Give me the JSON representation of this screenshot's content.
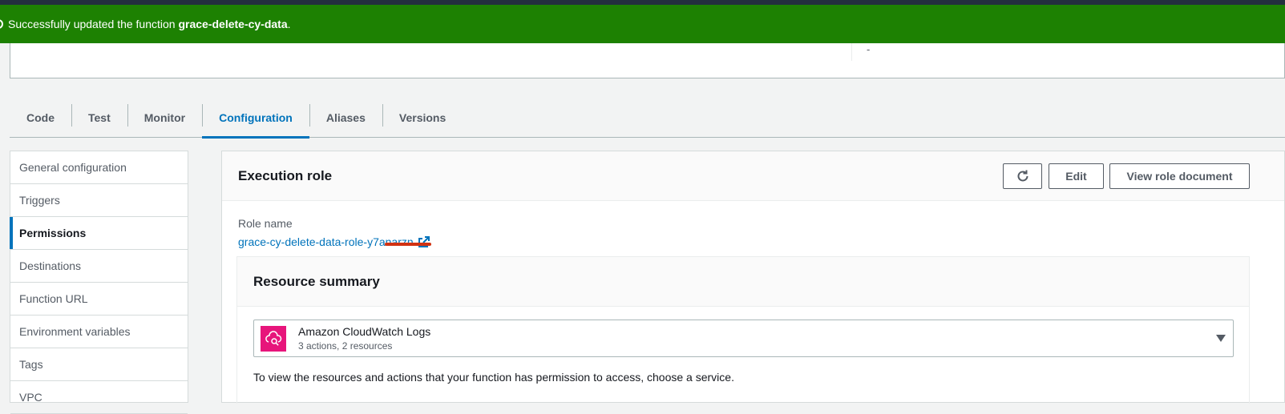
{
  "flash": {
    "prefix": "Successfully updated the function ",
    "function_name": "grace-delete-cy-data",
    "suffix": "."
  },
  "header": {
    "dash": "-"
  },
  "tabs": [
    {
      "label": "Code"
    },
    {
      "label": "Test"
    },
    {
      "label": "Monitor"
    },
    {
      "label": "Configuration",
      "active": true
    },
    {
      "label": "Aliases"
    },
    {
      "label": "Versions"
    }
  ],
  "sidebar": {
    "items": [
      {
        "label": "General configuration"
      },
      {
        "label": "Triggers"
      },
      {
        "label": "Permissions",
        "active": true
      },
      {
        "label": "Destinations"
      },
      {
        "label": "Function URL"
      },
      {
        "label": "Environment variables"
      },
      {
        "label": "Tags"
      },
      {
        "label": "VPC"
      }
    ]
  },
  "execution_role": {
    "title": "Execution role",
    "edit_label": "Edit",
    "view_doc_label": "View role document",
    "role_name_label": "Role name",
    "role_name_value": "grace-cy-delete-data-role-y7anarzn"
  },
  "resource_summary": {
    "title": "Resource summary",
    "service_name": "Amazon CloudWatch Logs",
    "service_sub": "3 actions, 2 resources",
    "hint": "To view the resources and actions that your function has permission to access, choose a service."
  },
  "colors": {
    "success": "#1d8102",
    "link": "#0073bb",
    "service_icon": "#e7157b"
  }
}
